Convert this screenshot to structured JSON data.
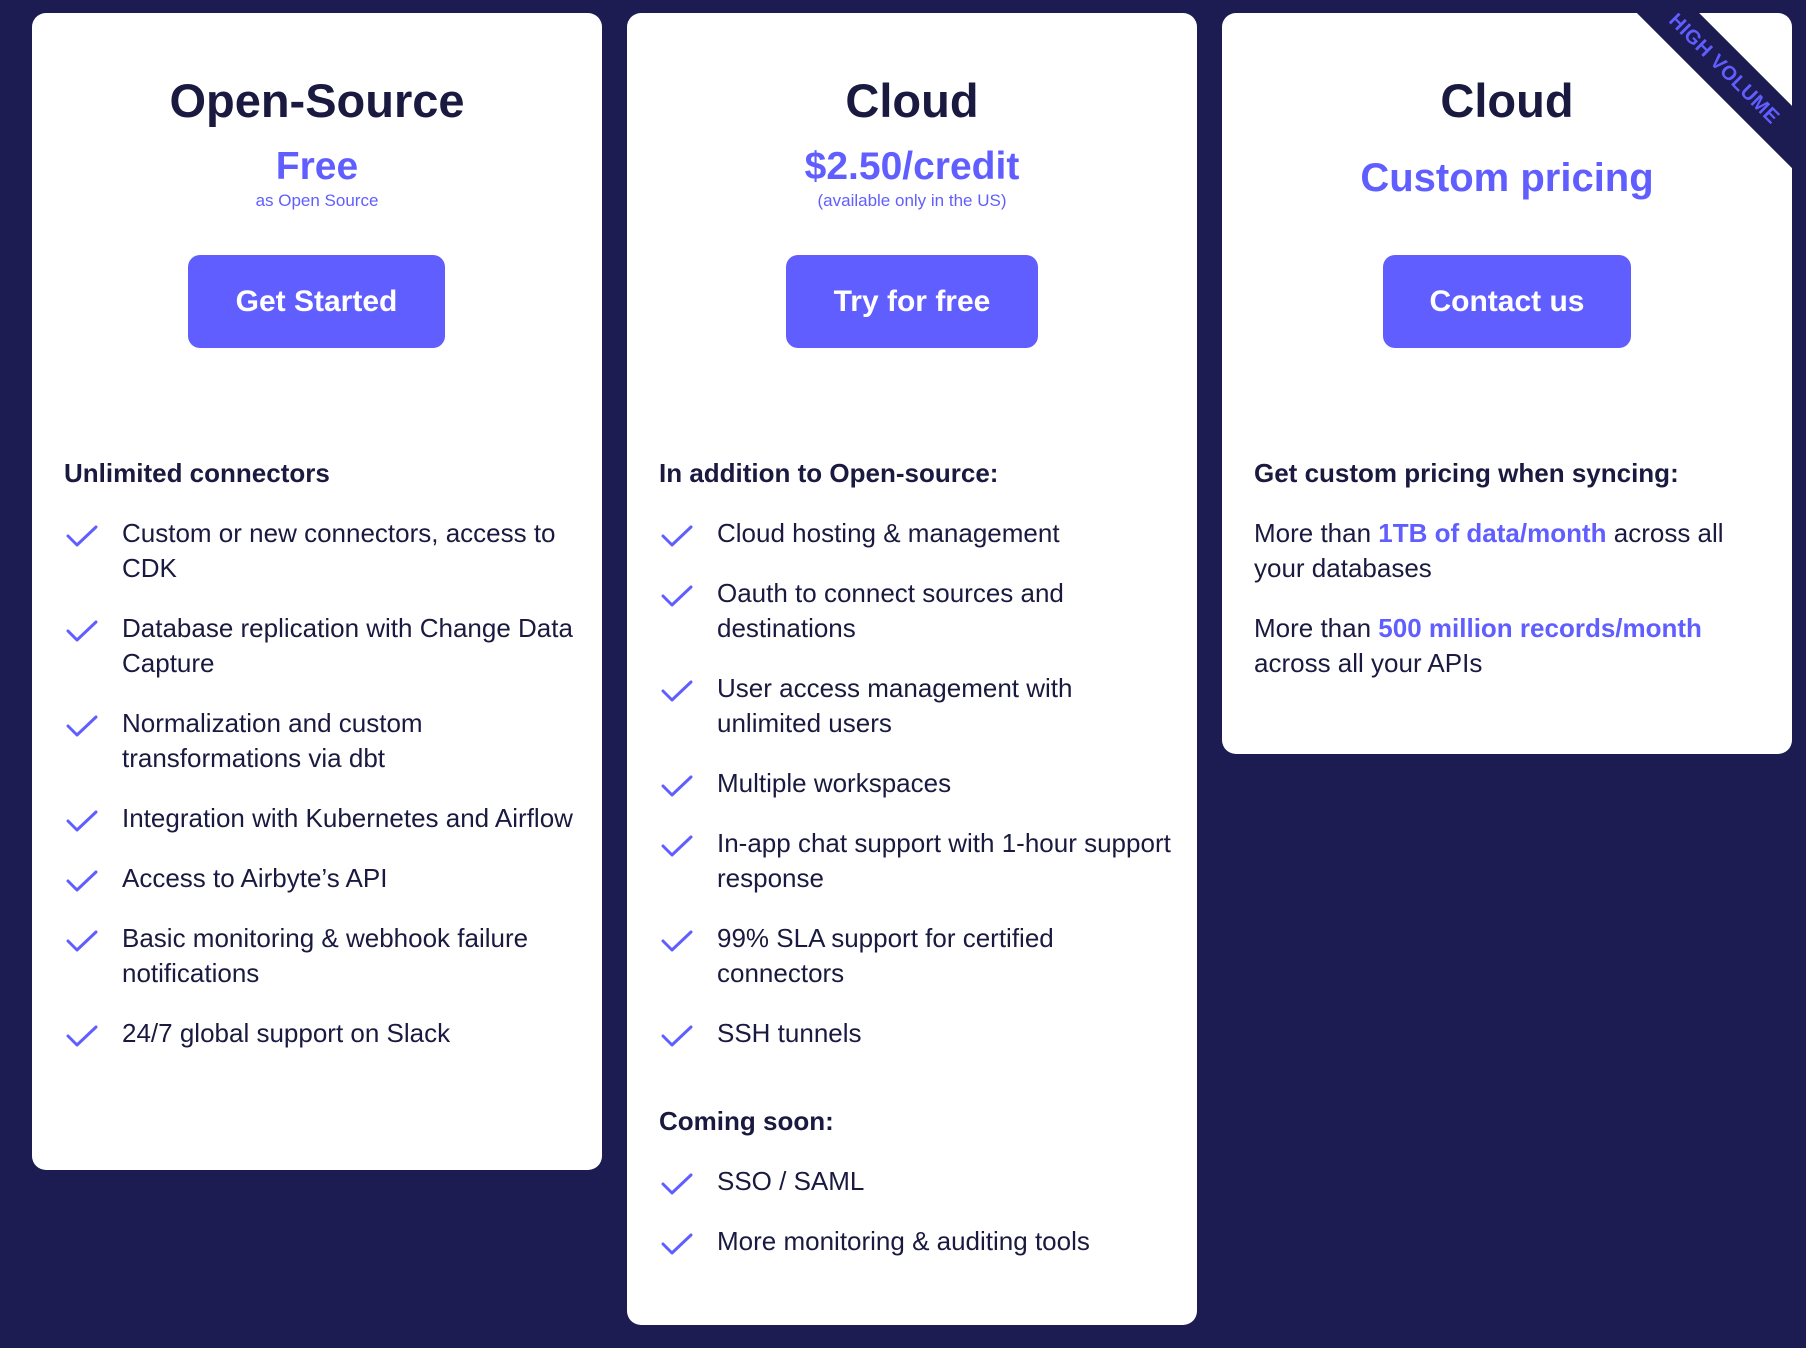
{
  "colors": {
    "background": "#1c1c52",
    "accent": "#615eff",
    "card": "#ffffff",
    "text": "#1a1a40"
  },
  "plans": {
    "open_source": {
      "title": "Open-Source",
      "price": "Free",
      "price_note": "as Open Source",
      "cta": "Get Started",
      "section_heading": "Unlimited connectors",
      "features": [
        "Custom or new connectors, access to CDK",
        "Database replication with Change Data Capture",
        "Normalization and custom transformations via dbt",
        "Integration with Kubernetes and Airflow",
        "Access to Airbyte’s API",
        "Basic monitoring & webhook failure notifications",
        "24/7 global support on Slack"
      ]
    },
    "cloud": {
      "title": "Cloud",
      "price": "$2.50/credit",
      "price_note": "(available only in the US)",
      "cta": "Try for free",
      "section_heading": "In addition to Open-source:",
      "features": [
        "Cloud hosting & management",
        "Oauth to connect sources and destinations",
        "User access management with unlimited users",
        "Multiple workspaces",
        "In-app chat support with 1-hour support response",
        "99% SLA support for certified connectors",
        "SSH tunnels"
      ],
      "coming_soon_heading": "Coming soon:",
      "coming_soon": [
        "SSO / SAML",
        "More monitoring & auditing tools"
      ]
    },
    "high_volume": {
      "ribbon": "HIGH VOLUME",
      "title": "Cloud",
      "price": "Custom pricing",
      "cta": "Contact us",
      "section_heading": "Get custom pricing when syncing:",
      "line1_prefix": "More than ",
      "line1_highlight": "1TB of data/month",
      "line1_suffix": " across all your databases",
      "line2_prefix": "More than ",
      "line2_highlight": "500 million records/month",
      "line2_suffix": " across all your APIs"
    }
  }
}
